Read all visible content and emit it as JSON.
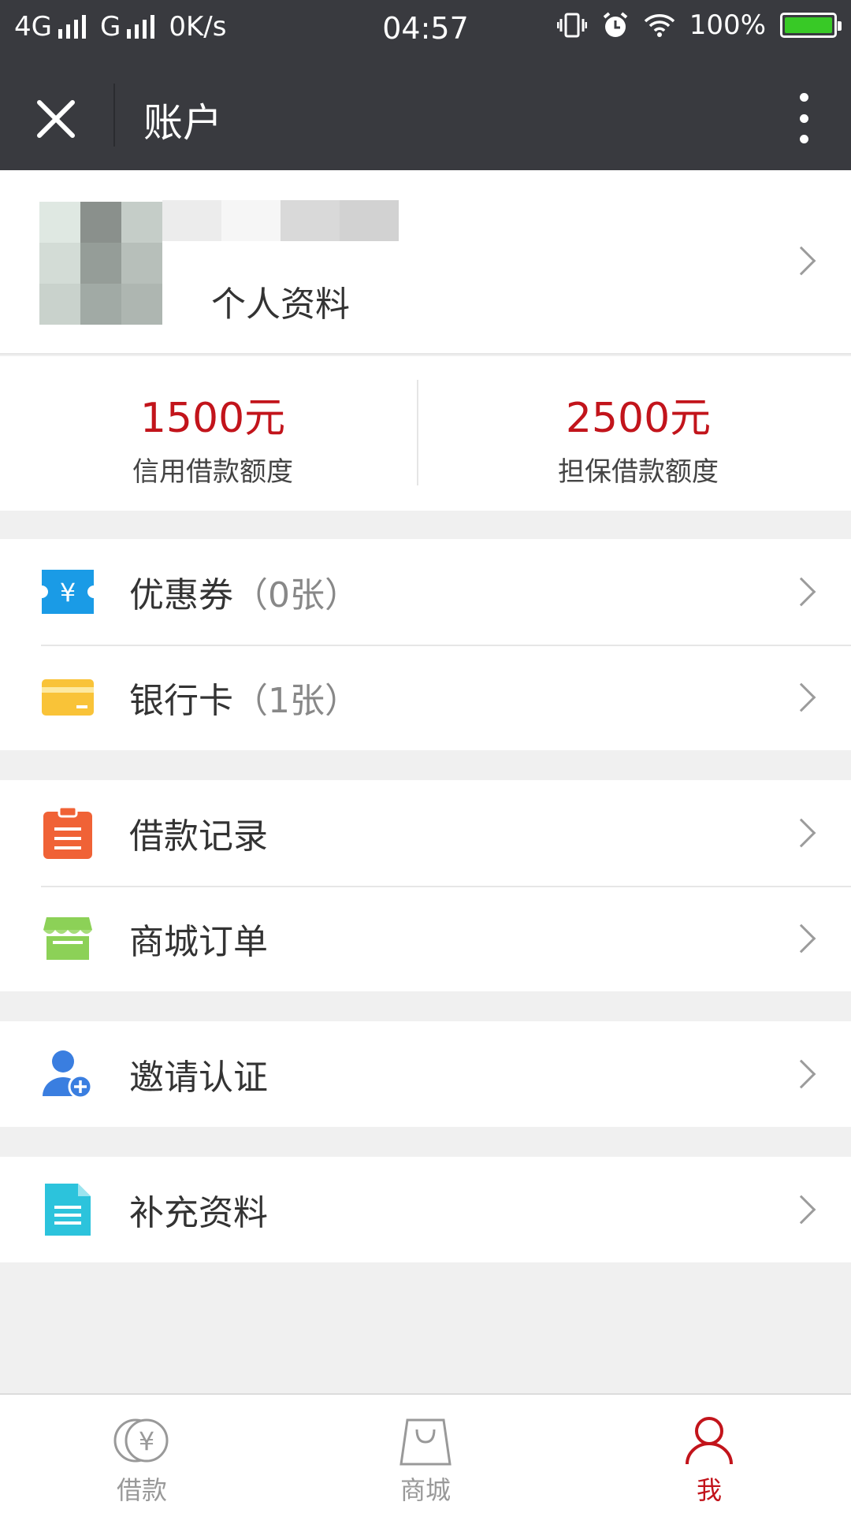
{
  "status_bar": {
    "network1": "4G",
    "network2": "G",
    "speed": "0K/s",
    "time": "04:57",
    "battery": "100%"
  },
  "header": {
    "title": "账户"
  },
  "profile": {
    "label": "个人资料"
  },
  "quota": [
    {
      "amount": "1500元",
      "label": "信用借款额度"
    },
    {
      "amount": "2500元",
      "label": "担保借款额度"
    }
  ],
  "menu": {
    "coupons": {
      "label": "优惠券",
      "count": "（0张）"
    },
    "bank_cards": {
      "label": "银行卡",
      "count": "（1张）"
    },
    "loan_records": {
      "label": "借款记录"
    },
    "mall_orders": {
      "label": "商城订单"
    },
    "invite_verify": {
      "label": "邀请认证"
    },
    "supplement_info": {
      "label": "补充资料"
    }
  },
  "tabs": [
    {
      "label": "借款",
      "icon": "yuan-coin-icon"
    },
    {
      "label": "商城",
      "icon": "shopping-bag-icon"
    },
    {
      "label": "我",
      "icon": "user-icon",
      "active": true
    }
  ],
  "colors": {
    "accent": "#c2141b",
    "header_bg": "#393a3f",
    "coupon_icon": "#1a9be6",
    "card_icon": "#f9c338",
    "records_icon": "#f06236",
    "orders_icon": "#8cd157",
    "invite_icon": "#3a7ee0",
    "supplement_icon": "#2cc3dc"
  }
}
